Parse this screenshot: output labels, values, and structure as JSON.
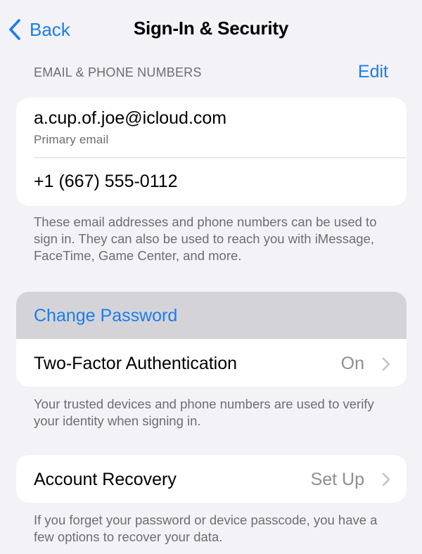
{
  "nav": {
    "back_label": "Back",
    "title": "Sign-In & Security"
  },
  "email_section": {
    "header": "EMAIL & PHONE NUMBERS",
    "edit_label": "Edit",
    "email": "a.cup.of.joe@icloud.com",
    "email_subtitle": "Primary email",
    "phone": "+1 (667) 555-0112",
    "footer": "These email addresses and phone numbers can be used to sign in. They can also be used to reach you with iMessage, FaceTime, Game Center, and more."
  },
  "security_section": {
    "change_password_label": "Change Password",
    "two_factor_label": "Two-Factor Authentication",
    "two_factor_value": "On",
    "footer": "Your trusted devices and phone numbers are used to verify your identity when signing in."
  },
  "recovery_section": {
    "account_recovery_label": "Account Recovery",
    "account_recovery_value": "Set Up",
    "footer": "If you forget your password or device passcode, you have a few options to recover your data."
  },
  "colors": {
    "accent": "#1b7cf2",
    "background": "#f2f2f7",
    "secondary_text": "#6d6d72",
    "highlight": "#d4d4d8"
  },
  "icons": {
    "back": "chevron-left-icon",
    "disclosure": "chevron-right-icon"
  }
}
